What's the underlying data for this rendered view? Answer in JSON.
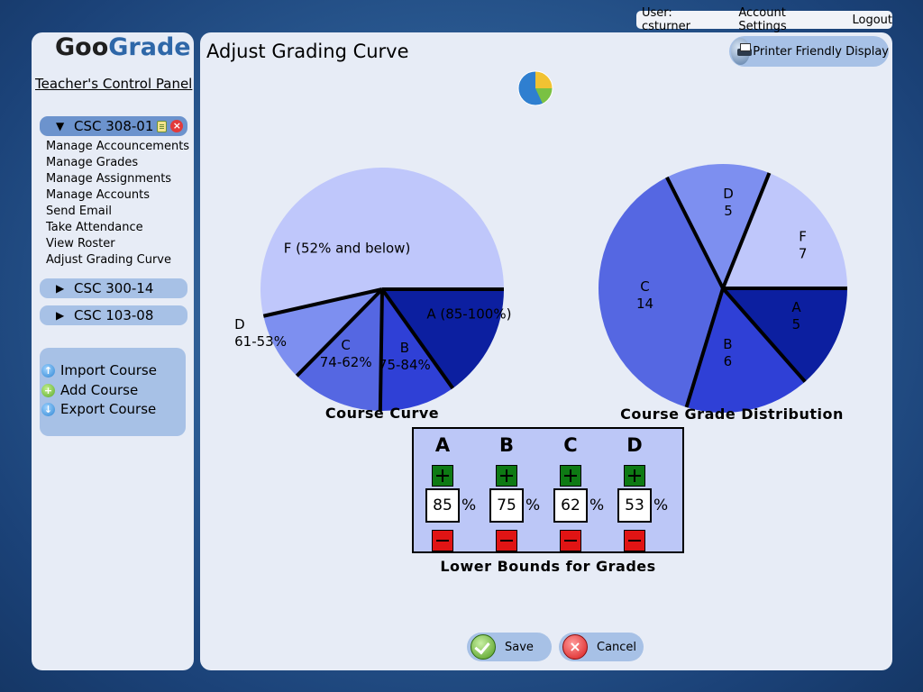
{
  "user_bar": {
    "user": "User: csturner",
    "account_settings": "Account Settings",
    "logout": "Logout"
  },
  "sidebar": {
    "logo_goo": "Goo",
    "logo_grade": "Grade",
    "panel_title": "Teacher's Control Panel",
    "courses": [
      {
        "label": "CSC 308-01",
        "expanded": true,
        "arrow": "▼"
      },
      {
        "label": "CSC 300-14",
        "expanded": false,
        "arrow": "▶"
      },
      {
        "label": "CSC 103-08",
        "expanded": false,
        "arrow": "▶"
      }
    ],
    "course_menu": [
      "Manage Accouncements",
      "Manage Grades",
      "Manage Assignments",
      "Manage Accounts",
      "Send Email",
      "Take Attendance",
      "View Roster",
      "Adjust Grading Curve"
    ],
    "actions": [
      {
        "label": "Import Course",
        "icon": "upload-icon"
      },
      {
        "label": "Add Course",
        "icon": "add-icon"
      },
      {
        "label": "Export Course",
        "icon": "download-icon"
      }
    ]
  },
  "main": {
    "title": "Adjust Grading Curve",
    "printer_button": "Printer Friendly Display",
    "curve_caption": "Course Curve",
    "distribution_caption": "Course Grade Distribution",
    "bounds": {
      "caption": "Lower Bounds for Grades",
      "percent_symbol": "%",
      "grades": [
        {
          "letter": "A",
          "value": "85"
        },
        {
          "letter": "B",
          "value": "75"
        },
        {
          "letter": "C",
          "value": "62"
        },
        {
          "letter": "D",
          "value": "53"
        }
      ]
    },
    "save_label": "Save",
    "cancel_label": "Cancel"
  },
  "chart_data": [
    {
      "type": "pie",
      "title": "Course Curve",
      "slices": [
        {
          "label": "A (85-100%)",
          "value": 15,
          "color": "#0c1fa0"
        },
        {
          "label": "B 75-84%",
          "value": 10,
          "color": "#2f40d6"
        },
        {
          "label": "C 74-62%",
          "value": 12,
          "color": "#5567e2"
        },
        {
          "label": "D 61-53%",
          "value": 9,
          "color": "#7d8ff0"
        },
        {
          "label": "F (52% and below)",
          "value": 53,
          "color": "#bfc7fb"
        }
      ]
    },
    {
      "type": "pie",
      "title": "Course Grade Distribution",
      "slices": [
        {
          "label": "A",
          "value": 5,
          "color": "#0c1fa0"
        },
        {
          "label": "B",
          "value": 6,
          "color": "#2f40d6"
        },
        {
          "label": "C",
          "value": 14,
          "color": "#5567e2"
        },
        {
          "label": "D",
          "value": 5,
          "color": "#7d8ff0"
        },
        {
          "label": "F",
          "value": 7,
          "color": "#bfc7fb"
        }
      ]
    }
  ]
}
